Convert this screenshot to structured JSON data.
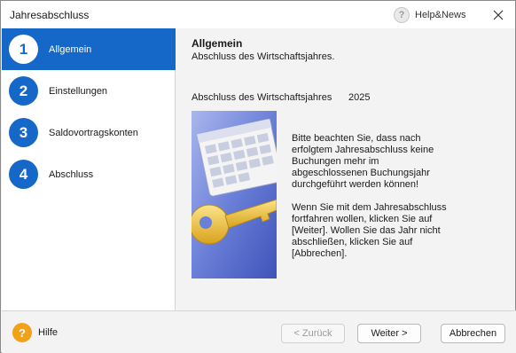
{
  "window": {
    "title": "Jahresabschluss",
    "help_news_label": "Help&News"
  },
  "steps": [
    {
      "number": "1",
      "label": "Allgemein",
      "active": true
    },
    {
      "number": "2",
      "label": "Einstellungen",
      "active": false
    },
    {
      "number": "3",
      "label": "Saldovortragskonten",
      "active": false
    },
    {
      "number": "4",
      "label": "Abschluss",
      "active": false
    }
  ],
  "header": {
    "title": "Allgemein",
    "subtitle": "Abschluss des Wirtschaftsjahres."
  },
  "fiscal_year": {
    "label": "Abschluss des Wirtschaftsjahres",
    "value": "2025"
  },
  "info": {
    "paragraph1": "Bitte beachten Sie, dass nach erfolgtem Jahresabschluss keine Buchungen mehr im abgeschlossenen Buchungsjahr durchgeführt werden können!",
    "paragraph2": "Wenn Sie mit dem Jahresabschluss fortfahren wollen, klicken Sie auf [Weiter]. Wollen Sie das Jahr nicht abschließen, klicken Sie auf [Abbrechen]."
  },
  "footer": {
    "help_label": "Hilfe",
    "back_label": "< Zurück",
    "next_label": "Weiter >",
    "cancel_label": "Abbrechen"
  },
  "colors": {
    "accent": "#1668c8",
    "help_orange": "#f1a21b",
    "illustration_blue": "#5a6fd0"
  },
  "icons": {
    "help_news": "question-circle-icon",
    "close": "close-icon",
    "help": "question-circle-orange-icon",
    "illustration": "calendar-key-illustration"
  }
}
